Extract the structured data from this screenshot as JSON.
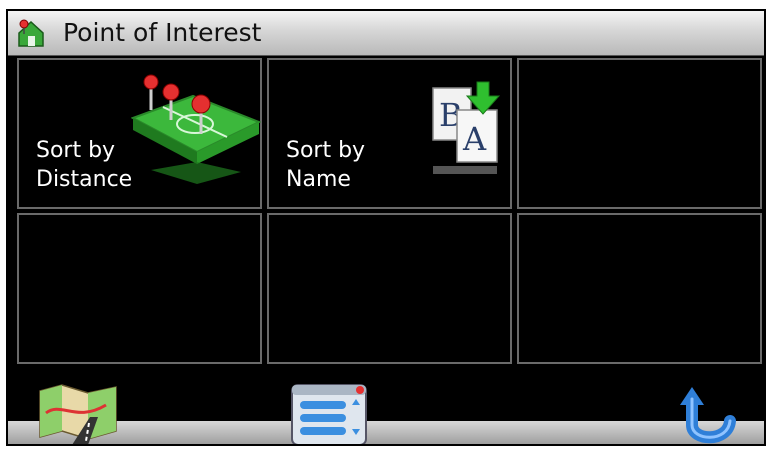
{
  "window": {
    "title": "Point of Interest",
    "title_icon": "poi-house-icon"
  },
  "tiles": [
    {
      "label": "Sort by\nDistance",
      "icon": "map-pins-icon"
    },
    {
      "label": "Sort by\nName",
      "icon": "sort-ab-icon"
    },
    {
      "label": "",
      "icon": ""
    },
    {
      "label": "",
      "icon": ""
    },
    {
      "label": "",
      "icon": ""
    },
    {
      "label": "",
      "icon": ""
    }
  ],
  "toolbar": {
    "map_button_icon": "map-icon",
    "list_button_icon": "list-menu-icon",
    "back_button_icon": "back-arrow-icon"
  },
  "colors": {
    "background": "#000000",
    "tile_border": "#6a6a6a",
    "title_bar": "#d0d0d0",
    "accent_green": "#3cb83c",
    "accent_blue": "#2f7fd8"
  }
}
